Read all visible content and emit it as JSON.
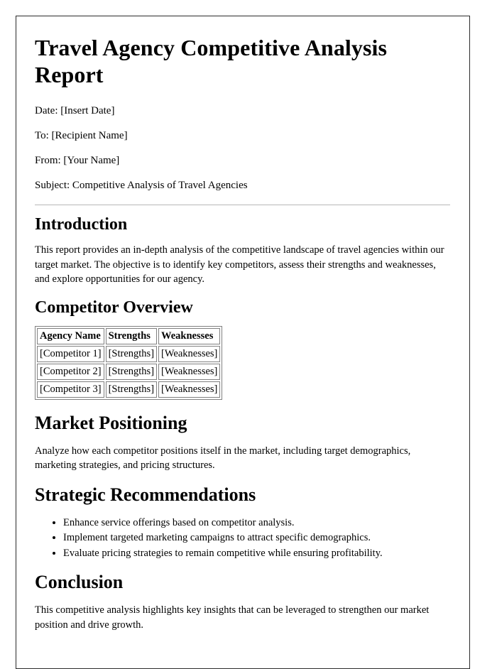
{
  "document": {
    "title": "Travel Agency Competitive Analysis Report",
    "meta": {
      "date_line": "Date: [Insert Date]",
      "to_line": "To: [Recipient Name]",
      "from_line": "From: [Your Name]",
      "subject_line": "Subject: Competitive Analysis of Travel Agencies"
    },
    "sections": {
      "introduction": {
        "heading": "Introduction",
        "paragraph": "This report provides an in-depth analysis of the competitive landscape of travel agencies within our target market. The objective is to identify key competitors, assess their strengths and weaknesses, and explore opportunities for our agency."
      },
      "competitor_overview": {
        "heading": "Competitor Overview",
        "table": {
          "columns": [
            "Agency Name",
            "Strengths",
            "Weaknesses"
          ],
          "rows": [
            [
              "[Competitor 1]",
              "[Strengths]",
              "[Weaknesses]"
            ],
            [
              "[Competitor 2]",
              "[Strengths]",
              "[Weaknesses]"
            ],
            [
              "[Competitor 3]",
              "[Strengths]",
              "[Weaknesses]"
            ]
          ]
        }
      },
      "market_positioning": {
        "heading": "Market Positioning",
        "paragraph": "Analyze how each competitor positions itself in the market, including target demographics, marketing strategies, and pricing structures."
      },
      "strategic_recommendations": {
        "heading": "Strategic Recommendations",
        "bullets": [
          "Enhance service offerings based on competitor analysis.",
          "Implement targeted marketing campaigns to attract specific demographics.",
          "Evaluate pricing strategies to remain competitive while ensuring profitability."
        ]
      },
      "conclusion": {
        "heading": "Conclusion",
        "paragraph": "This competitive analysis highlights key insights that can be leveraged to strengthen our market position and drive growth."
      }
    }
  }
}
